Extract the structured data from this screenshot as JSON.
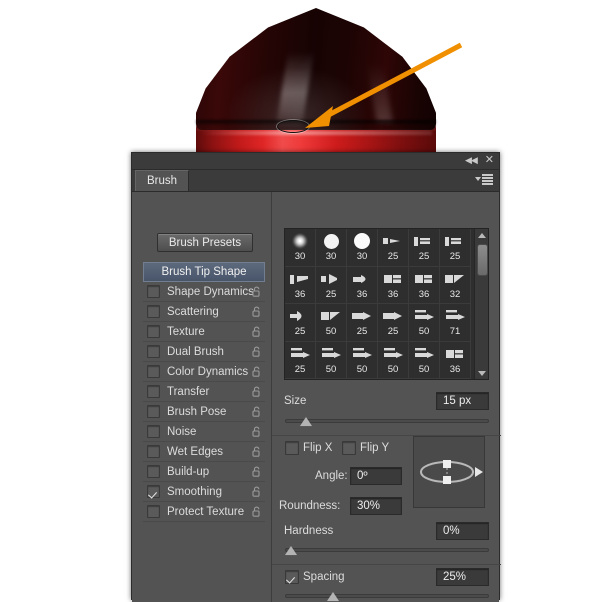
{
  "app": {
    "panel_title": "Brush",
    "tab_label": "Brush",
    "collapse_icon": "collapse-icon",
    "close_icon": "close-icon",
    "menu_icon": "panel-menu-icon"
  },
  "artwork": {
    "description": "red rocket pencil tip illustration",
    "selection_marquee": "elliptical-marquee"
  },
  "annotations": {
    "arrow_color": "#F09000",
    "arrow_to_artwork": "arrow-pointing-to-ellipse",
    "arrow_to_size": "arrow-pointing-to-size-field",
    "arrow_to_roundness": "arrow-pointing-to-roundness-field"
  },
  "left_panel": {
    "presets_button": "Brush Presets",
    "header_item": "Brush Tip Shape",
    "items": [
      {
        "label": "Shape Dynamics",
        "checked": false,
        "locked": false
      },
      {
        "label": "Scattering",
        "checked": false,
        "locked": false
      },
      {
        "label": "Texture",
        "checked": false,
        "locked": false
      },
      {
        "label": "Dual Brush",
        "checked": false,
        "locked": false
      },
      {
        "label": "Color Dynamics",
        "checked": false,
        "locked": false
      },
      {
        "label": "Transfer",
        "checked": false,
        "locked": false
      },
      {
        "label": "Brush Pose",
        "checked": false,
        "locked": false
      },
      {
        "label": "Noise",
        "checked": false,
        "locked": false
      },
      {
        "label": "Wet Edges",
        "checked": false,
        "locked": false
      },
      {
        "label": "Build-up",
        "checked": false,
        "locked": false
      },
      {
        "label": "Smoothing",
        "checked": true,
        "locked": false
      },
      {
        "label": "Protect Texture",
        "checked": false,
        "locked": false
      }
    ]
  },
  "brush_grid": {
    "rows": [
      [
        {
          "size": "30",
          "shape": "soft-round"
        },
        {
          "size": "30",
          "shape": "hard-round"
        },
        {
          "size": "30",
          "shape": "hard-round-2"
        },
        {
          "size": "25",
          "shape": "flat-tip"
        },
        {
          "size": "25",
          "shape": "block-tip"
        },
        {
          "size": "25",
          "shape": "block-tip"
        }
      ],
      [
        {
          "size": "36",
          "shape": "angled-tip"
        },
        {
          "size": "25",
          "shape": "fan-tip"
        },
        {
          "size": "36",
          "shape": "round-point"
        },
        {
          "size": "36",
          "shape": "square-tip"
        },
        {
          "size": "36",
          "shape": "square-tip"
        },
        {
          "size": "32",
          "shape": "angled-flat"
        }
      ],
      [
        {
          "size": "25",
          "shape": "cone-tip"
        },
        {
          "size": "50",
          "shape": "angled-flat"
        },
        {
          "size": "25",
          "shape": "marker-tip"
        },
        {
          "size": "25",
          "shape": "marker-tip"
        },
        {
          "size": "50",
          "shape": "pencil-tip"
        },
        {
          "size": "71",
          "shape": "pencil-tip"
        }
      ],
      [
        {
          "size": "25",
          "shape": "pencil-tip"
        },
        {
          "size": "50",
          "shape": "pencil-tip"
        },
        {
          "size": "50",
          "shape": "pencil-tip"
        },
        {
          "size": "50",
          "shape": "pencil-tip"
        },
        {
          "size": "50",
          "shape": "pencil-tip"
        },
        {
          "size": "36",
          "shape": "square-tip"
        }
      ],
      [
        {
          "size": "",
          "shape": "pencil-tip"
        },
        {
          "size": "",
          "shape": "pencil-tip"
        },
        {
          "size": "",
          "shape": "marker-tip"
        },
        {
          "size": "",
          "shape": "marker-tip"
        },
        {
          "size": "",
          "shape": "marker-tip"
        },
        {
          "size": "",
          "shape": "marker-tip"
        }
      ]
    ]
  },
  "controls": {
    "size": {
      "label": "Size",
      "value": "15 px",
      "slider_percent": 8
    },
    "flip_x": {
      "label": "Flip X",
      "checked": false
    },
    "flip_y": {
      "label": "Flip Y",
      "checked": false
    },
    "angle": {
      "label": "Angle:",
      "value": "0º"
    },
    "roundness": {
      "label": "Roundness:",
      "value": "30%"
    },
    "hardness": {
      "label": "Hardness",
      "value": "0%",
      "slider_percent": 0
    },
    "spacing": {
      "label": "Spacing",
      "value": "25%",
      "checked": true,
      "slider_percent": 22
    }
  }
}
